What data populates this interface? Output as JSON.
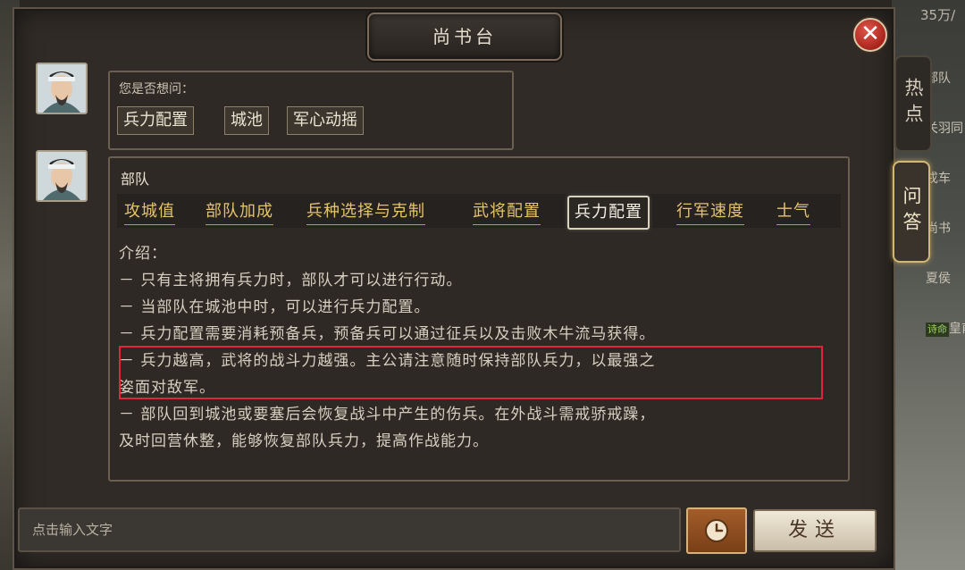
{
  "window": {
    "title": "尚书台",
    "close_label": "✕"
  },
  "top_resource": "35万/",
  "side_tabs": {
    "hot": "热点",
    "qa": "问答"
  },
  "background_list": [
    "部队",
    "关羽同",
    "戎车",
    "尚书",
    "夏侯",
    "皇甫"
  ],
  "background_tag": "诗命",
  "question_bubble": {
    "prompt": "您是否想问：",
    "options": [
      "兵力配置",
      "城池",
      "军心动摇"
    ]
  },
  "answer_bubble": {
    "title": "部队",
    "tabs": [
      "攻城值",
      "部队加成",
      "兵种选择与克制",
      "武将配置",
      "兵力配置",
      "行军速度",
      "士气"
    ],
    "active_tab": "兵力配置",
    "lines": [
      "介绍：",
      "－ 只有主将拥有兵力时，部队才可以进行行动。",
      "－ 当部队在城池中时，可以进行兵力配置。",
      "－ 兵力配置需要消耗预备兵，预备兵可以通过征兵以及击败木牛流马获得。",
      "－ 兵力越高，武将的战斗力越强。主公请注意随时保持部队兵力，以最强之",
      "姿面对敌军。",
      "－ 部队回到城池或要塞后会恢复战斗中产生的伤兵。在外战斗需戒骄戒躁，",
      "及时回营休整，能够恢复部队兵力，提高作战能力。"
    ]
  },
  "input": {
    "placeholder": "点击输入文字",
    "value": ""
  },
  "send_label": "发送",
  "icons": {
    "clock": "clock-icon",
    "close": "close-icon",
    "avatar": "advisor-portrait"
  },
  "colors": {
    "highlight": "#e3243b",
    "tab_gold": "#e4c46a"
  }
}
